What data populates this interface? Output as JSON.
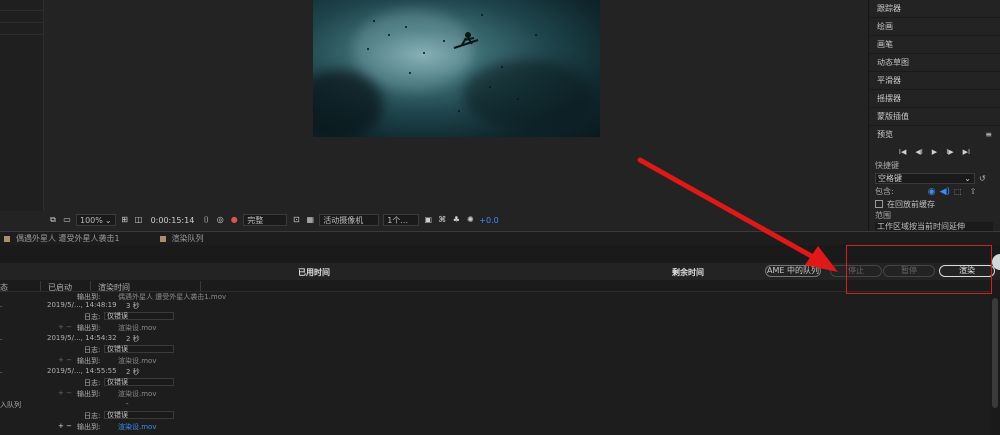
{
  "viewer_bar": {
    "zoom": "100%",
    "timecode": "0:00:15:14",
    "resolution": "完整",
    "camera": "活动摄像机",
    "views": "1个...",
    "exposure": "+0.0"
  },
  "right_panel": {
    "items": [
      "跟踪器",
      "绘画",
      "画笔",
      "动态草图",
      "平滑器",
      "摇摆器",
      "蒙版插值"
    ],
    "preview_title": "预览",
    "shortcut_label": "快捷键",
    "shortcut_value": "空格键",
    "include_label": "包含:",
    "cache_label": "在回放前缓存",
    "range_label": "范围",
    "range_value": "工作区域按当前时间延伸"
  },
  "render_queue": {
    "tabs": [
      "偶遇外星人 遭受外星人袭击1",
      "渲染队列"
    ],
    "elapsed_label": "已用时间",
    "remaining_label": "剩余时间",
    "buttons": {
      "ame": "AME 中的队列",
      "stop": "停止",
      "pause": "暂停",
      "render": "渲染"
    },
    "columns": [
      "态",
      "已启动",
      "渲染时间"
    ],
    "rows": [
      {
        "log_label": "输出到:",
        "output": "偶遇外星人 遭受外星人袭击1.mov"
      },
      {
        "started": "2019/5/..., 14:48:19",
        "time": "3 秒"
      },
      {
        "log_label": "日志:",
        "log_value": "仅错误"
      },
      {
        "output_label": "输出到:",
        "output": "渲染设.mov"
      },
      {
        "started": "2019/5/..., 14:54:32",
        "time": "2 秒"
      },
      {
        "log_label": "日志:",
        "log_value": "仅错误"
      },
      {
        "output_label": "输出到:",
        "output": "渲染设.mov"
      },
      {
        "started": "2019/5/..., 14:55:55",
        "time": "2 秒"
      },
      {
        "log_label": "日志:",
        "log_value": "仅错误"
      },
      {
        "output_label": "输出到:",
        "output": "渲染设.mov"
      },
      {
        "status": "入队列",
        "time": "-"
      },
      {
        "log_label": "日志:",
        "log_value": "仅错误"
      },
      {
        "output_label": "输出到:",
        "output": "渲染设.mov"
      }
    ]
  }
}
